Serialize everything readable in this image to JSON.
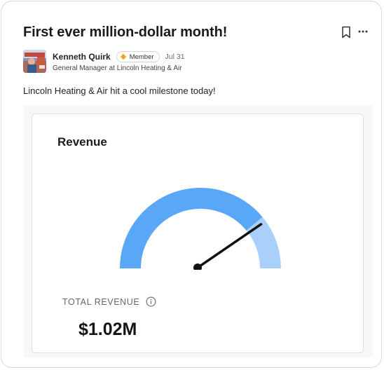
{
  "post": {
    "title": "First ever million-dollar month!",
    "body": "Lincoln Heating & Air hit a cool milestone today!"
  },
  "author": {
    "name": "Kenneth Quirk",
    "badge": "Member",
    "date": "Jul 31",
    "role": "General Manager at Lincoln Heating & Air"
  },
  "actions": {
    "bookmark_icon": "bookmark-icon",
    "more_icon": "more-horizontal-icon"
  },
  "widget": {
    "title": "Revenue",
    "metric_label": "TOTAL REVENUE",
    "metric_value": "$1.02M",
    "info_icon": "info-icon",
    "gauge": {
      "fill_fraction": 0.78,
      "needle_fraction": 0.78,
      "fill_color": "#5aa7f7",
      "track_color": "#a9d0fb",
      "needle_color": "#111111"
    }
  },
  "colors": {
    "badge_diamond": "#f2a31b",
    "title_text": "#1b1b1b"
  }
}
